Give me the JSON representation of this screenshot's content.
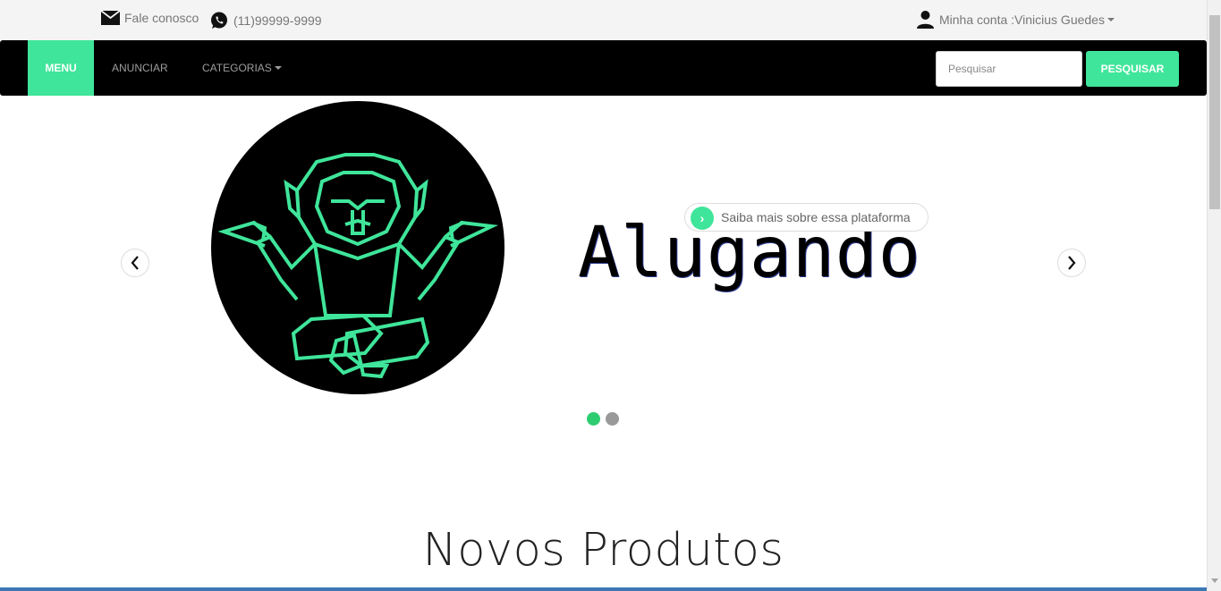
{
  "topbar": {
    "contact_label": "Fale conosco",
    "phone_label": "(11)99999-9999",
    "account_label": "Minha conta :Vinicius Guedes"
  },
  "navbar": {
    "menu_label": "MENU",
    "anunciar_label": "ANUNCIAR",
    "categorias_label": "CATEGORIAS",
    "search_placeholder": "Pesquisar",
    "search_button_label": "PESQUISAR"
  },
  "carousel": {
    "brand_title": "Alugando",
    "info_text": "Saiba mais sobre essa plataforma",
    "active_slide": 1,
    "slide_count": 2
  },
  "section": {
    "title": "Novos Produtos"
  },
  "colors": {
    "accent": "#3fe59a",
    "navbar_bg": "#000000",
    "dot_active": "#2ecc71"
  }
}
